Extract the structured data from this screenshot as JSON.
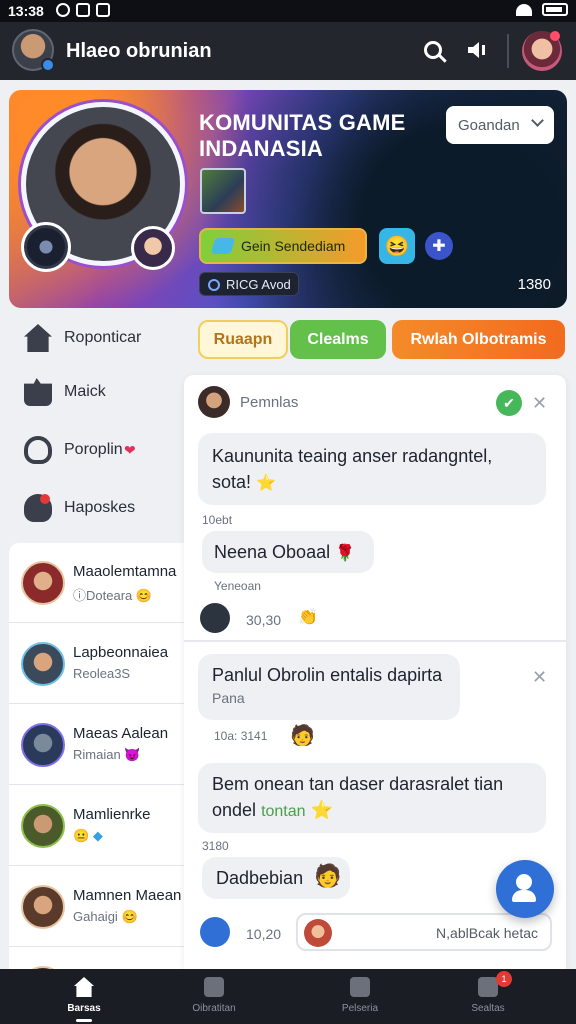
{
  "status_bar": {
    "time": "13:38"
  },
  "app_bar": {
    "title": "Hlaeo obrunian"
  },
  "hero": {
    "title": "KOMUNITAS GAME INDANASIA",
    "select_value": "Goandan",
    "join_label": "Gein Sendediam",
    "chip_label": "RICG Avod",
    "count": "1380"
  },
  "nav": [
    {
      "label": "Roponticar",
      "icon": "home-icon"
    },
    {
      "label": "Maick",
      "icon": "puzzle-icon"
    },
    {
      "label": "Poroplin",
      "icon": "person-icon"
    },
    {
      "label": "Haposkes",
      "icon": "group-icon"
    }
  ],
  "tabs": [
    {
      "label": "Ruaapn"
    },
    {
      "label": "Clealms"
    },
    {
      "label": "Rwlah Olbotramis"
    }
  ],
  "friends": [
    {
      "name": "Maaolemtamna",
      "sub": "Doteara",
      "emoji": "😊"
    },
    {
      "name": "Lapbeonnaiea",
      "sub": "Reolea3S",
      "emoji": ""
    },
    {
      "name": "Maeas Aalean",
      "sub": "Rimaian",
      "emoji": "😈"
    },
    {
      "name": "Mamlienrke",
      "sub": "",
      "emoji": "😐"
    },
    {
      "name": "Mamnen Maean",
      "sub": "Gahaigi",
      "emoji": "😊"
    }
  ],
  "chat": {
    "header_name": "Pemnlas",
    "msg1": "Kaununita teaing anser radangntel, sota!",
    "msg1_time": "10ebt",
    "msg2": "Neena Oboaal",
    "msg2_time": "Yeneoan",
    "reaction1_time": "30,30",
    "msg3_title": "Panlul Obrolin entalis dapirta",
    "msg3_sub": "Pana",
    "msg3_time": "10a: 3141",
    "msg4_a": "Bem onean tan daser darasralet tian",
    "msg4_b": "ondel",
    "msg4_highlight": "tontan",
    "msg4_time": "3180",
    "msg5": "Dadbebian",
    "reaction2_time": "10,20",
    "input_placeholder": "N,ablBcak hetac"
  },
  "bottom_nav": [
    {
      "label": "Barsas",
      "icon": "home-icon"
    },
    {
      "label": "Oibratitan",
      "icon": "chat-icon"
    },
    {
      "label": "Pelseria",
      "icon": "gallery-icon"
    },
    {
      "label": "Sealtas",
      "icon": "friends-icon",
      "badge": "1"
    }
  ]
}
